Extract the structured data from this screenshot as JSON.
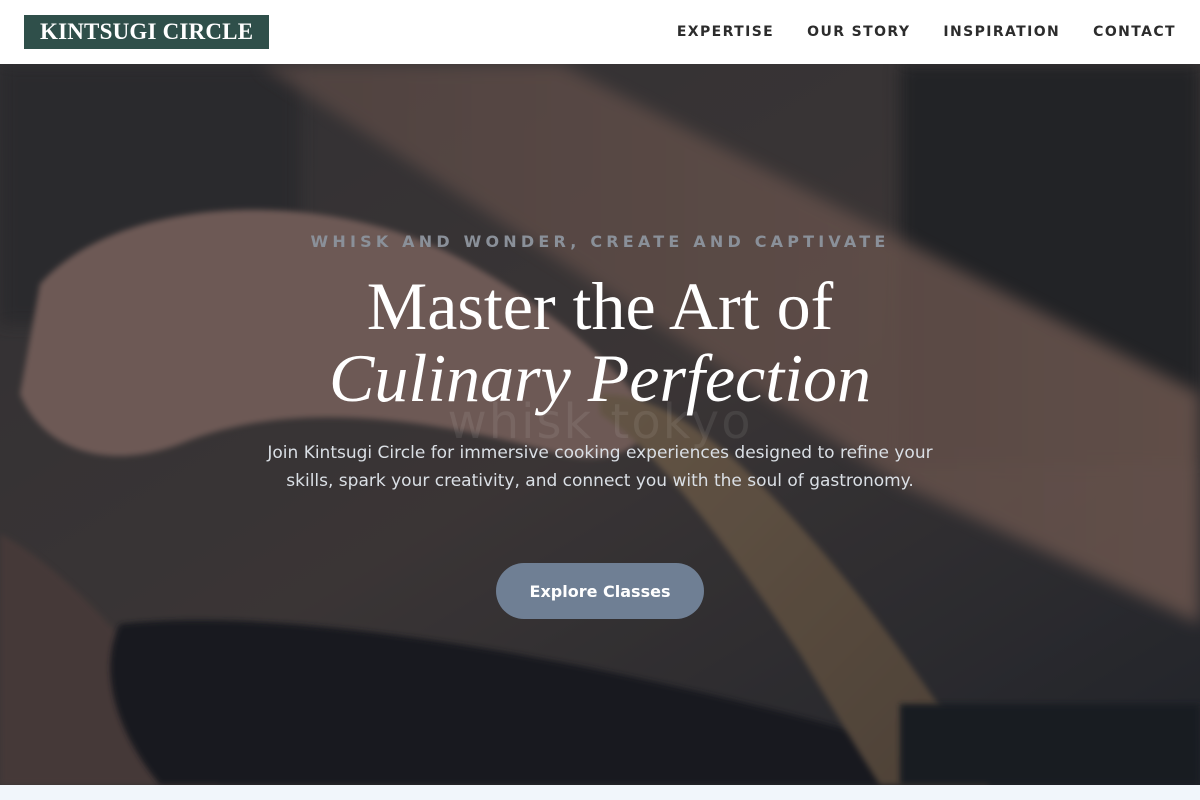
{
  "brand": {
    "name": "KINTSUGI CIRCLE",
    "logo_bg": "#2f4f4a"
  },
  "nav": {
    "items": [
      {
        "label": "EXPERTISE"
      },
      {
        "label": "OUR STORY"
      },
      {
        "label": "INSPIRATION"
      },
      {
        "label": "CONTACT"
      }
    ]
  },
  "hero": {
    "eyebrow": "WHISK AND WONDER, CREATE AND CAPTIVATE",
    "headline_line1": "Master the Art of",
    "headline_line2": "Culinary Perfection",
    "subtext": "Join Kintsugi Circle for immersive cooking experiences designed to refine your skills, spark your creativity, and connect you with the soul of gastronomy.",
    "watermark": "whisk tokyo",
    "cta_label": "Explore Classes",
    "cta_color": "#6f7f94",
    "background_image": "cooking-hands-stirring-pan"
  }
}
